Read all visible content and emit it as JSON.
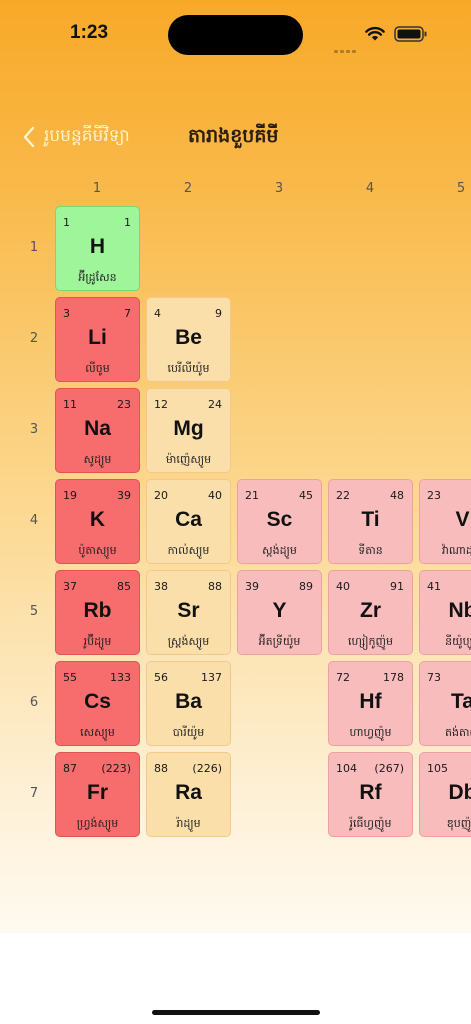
{
  "status_bar": {
    "time": "1:23"
  },
  "nav": {
    "back_label": "រូបមន្តគីមីវិទ្យា",
    "title": "តារាងខួបគីមី"
  },
  "column_numbers": [
    "1",
    "2",
    "3",
    "4",
    "5"
  ],
  "row_numbers": [
    "1",
    "2",
    "3",
    "4",
    "5",
    "6",
    "7"
  ],
  "colors": {
    "nonmetal": "#9ef59a",
    "alkali_metal": "#f76c6c",
    "alkaline_earth": "#fbdfab",
    "transition_metal": "#f9bcbc"
  },
  "elements": [
    {
      "number": "1",
      "mass": "1",
      "symbol": "H",
      "name": "អ៊ីដ្រូសែន",
      "type": "nonmetal"
    },
    {
      "number": "3",
      "mass": "7",
      "symbol": "Li",
      "name": "លីចូម",
      "type": "alkali"
    },
    {
      "number": "4",
      "mass": "9",
      "symbol": "Be",
      "name": "បេរីលីយ៉ូម",
      "type": "earth"
    },
    {
      "number": "11",
      "mass": "23",
      "symbol": "Na",
      "name": "សូដ្យូម",
      "type": "alkali"
    },
    {
      "number": "12",
      "mass": "24",
      "symbol": "Mg",
      "name": "ម៉ាញ៉េស្យូម",
      "type": "earth"
    },
    {
      "number": "19",
      "mass": "39",
      "symbol": "K",
      "name": "ប៉ូតាស្យូម",
      "type": "alkali"
    },
    {
      "number": "20",
      "mass": "40",
      "symbol": "Ca",
      "name": "កាល់ស្យូម",
      "type": "earth"
    },
    {
      "number": "21",
      "mass": "45",
      "symbol": "Sc",
      "name": "ស្កង់ដ្យូម",
      "type": "trans"
    },
    {
      "number": "22",
      "mass": "48",
      "symbol": "Ti",
      "name": "ទីតាន",
      "type": "trans"
    },
    {
      "number": "23",
      "mass": "",
      "symbol": "V",
      "name": "វ៉ាណាដ្យូម",
      "type": "trans"
    },
    {
      "number": "37",
      "mass": "85",
      "symbol": "Rb",
      "name": "រូប៊ីដ្យូម",
      "type": "alkali"
    },
    {
      "number": "38",
      "mass": "88",
      "symbol": "Sr",
      "name": "ស្រ្តង់ស្យូម",
      "type": "earth"
    },
    {
      "number": "39",
      "mass": "89",
      "symbol": "Y",
      "name": "អ៊ីតទ្រីយ៉ូម",
      "type": "trans"
    },
    {
      "number": "40",
      "mass": "91",
      "symbol": "Zr",
      "name": "ហ្សៀកូញ៉ូម",
      "type": "trans"
    },
    {
      "number": "41",
      "mass": "",
      "symbol": "Nb",
      "name": "នីយ៉ូប្យូម",
      "type": "trans"
    },
    {
      "number": "55",
      "mass": "133",
      "symbol": "Cs",
      "name": "សេស្យូម",
      "type": "alkali"
    },
    {
      "number": "56",
      "mass": "137",
      "symbol": "Ba",
      "name": "បារីយ៉ូម",
      "type": "earth"
    },
    {
      "number": "72",
      "mass": "178",
      "symbol": "Hf",
      "name": "ហាហ្វញ៉ូម",
      "type": "trans"
    },
    {
      "number": "73",
      "mass": "",
      "symbol": "Ta",
      "name": "តង់តាល",
      "type": "trans"
    },
    {
      "number": "87",
      "mass": "(223)",
      "symbol": "Fr",
      "name": "ហ្វ្រង់ស្យូម",
      "type": "alkali"
    },
    {
      "number": "88",
      "mass": "(226)",
      "symbol": "Ra",
      "name": "រ៉ាដ្យូម",
      "type": "earth"
    },
    {
      "number": "104",
      "mass": "(267)",
      "symbol": "Rf",
      "name": "រ៉ូធើហ្វញ៉ូម",
      "type": "trans"
    },
    {
      "number": "105",
      "mass": "",
      "symbol": "Db",
      "name": "ឌុបញ៉ូម",
      "type": "trans"
    }
  ]
}
